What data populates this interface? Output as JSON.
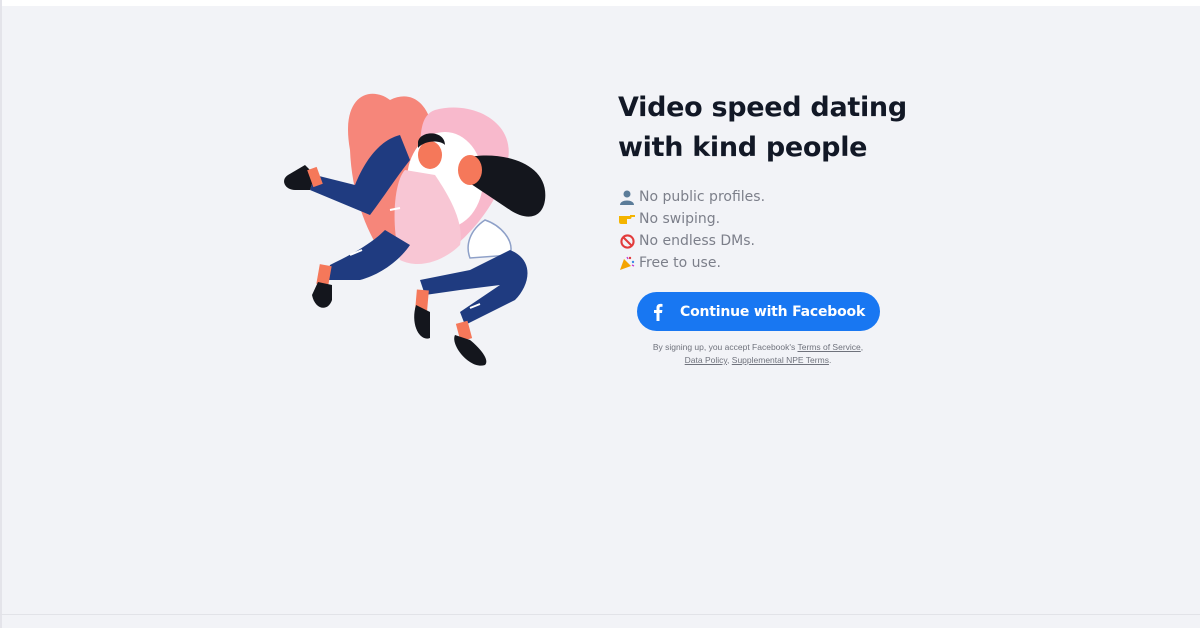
{
  "main": {
    "headline_line1": "Video speed dating",
    "headline_line2": "with kind people",
    "features": [
      {
        "icon": "person-silhouette-icon",
        "label": "No public profiles."
      },
      {
        "icon": "pointing-hand-icon",
        "label": "No swiping."
      },
      {
        "icon": "no-entry-icon",
        "label": "No endless DMs."
      },
      {
        "icon": "party-popper-icon",
        "label": "Free to use."
      }
    ],
    "facebook_button": {
      "icon": "facebook-f-icon",
      "label": "Continue with Facebook"
    },
    "disclaimer": {
      "prefix": "By signing up, you accept Facebook's",
      "terms_link": "Terms of Service",
      "sep1": ",",
      "data_policy_link": "Data Policy",
      "sep2": ",",
      "npe_terms_link": "Supplemental NPE Terms",
      "suffix": "."
    }
  },
  "illustration": {
    "icon": "couple-hugging-illustration",
    "colors": {
      "heart_back": "#f6867a",
      "heart_front": "#f8b9cc",
      "navy": "#1f3b80",
      "skin": "#f5785a",
      "dark": "#14161d"
    }
  },
  "colors": {
    "background": "#f2f3f7",
    "headline": "#121826",
    "feature_text": "#7c7f8a",
    "facebook_blue": "#1877f2"
  }
}
